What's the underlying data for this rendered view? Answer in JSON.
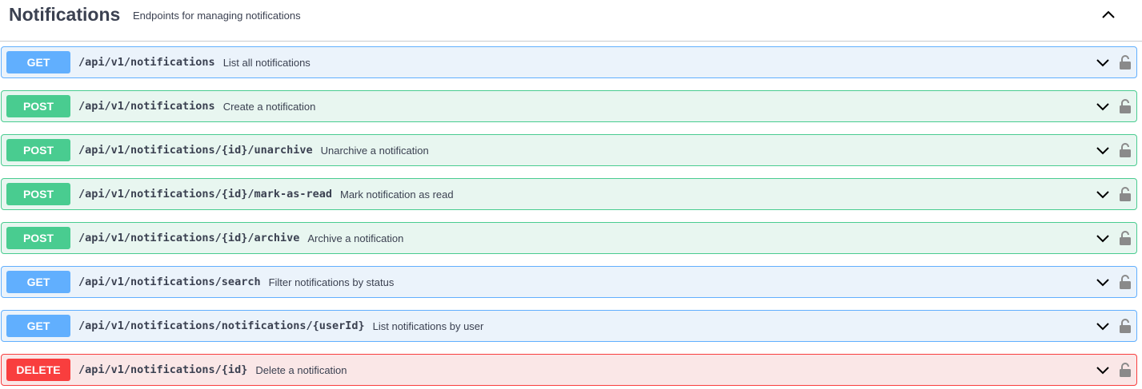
{
  "section": {
    "title": "Notifications",
    "description": "Endpoints for managing notifications"
  },
  "operations": [
    {
      "method": "GET",
      "path": "/api/v1/notifications",
      "summary": "List all notifications"
    },
    {
      "method": "POST",
      "path": "/api/v1/notifications",
      "summary": "Create a notification"
    },
    {
      "method": "POST",
      "path": "/api/v1/notifications/{id}/unarchive",
      "summary": "Unarchive a notification"
    },
    {
      "method": "POST",
      "path": "/api/v1/notifications/{id}/mark-as-read",
      "summary": "Mark notification as read"
    },
    {
      "method": "POST",
      "path": "/api/v1/notifications/{id}/archive",
      "summary": "Archive a notification"
    },
    {
      "method": "GET",
      "path": "/api/v1/notifications/search",
      "summary": "Filter notifications by status"
    },
    {
      "method": "GET",
      "path": "/api/v1/notifications/notifications/{userId}",
      "summary": "List notifications by user"
    },
    {
      "method": "DELETE",
      "path": "/api/v1/notifications/{id}",
      "summary": "Delete a notification"
    }
  ],
  "icons": {
    "collapse": "chevron-up-icon",
    "expand": "chevron-down-icon",
    "auth": "lock-icon"
  },
  "colors": {
    "get": "#61affe",
    "post": "#49cc90",
    "delete": "#f93e3e"
  }
}
